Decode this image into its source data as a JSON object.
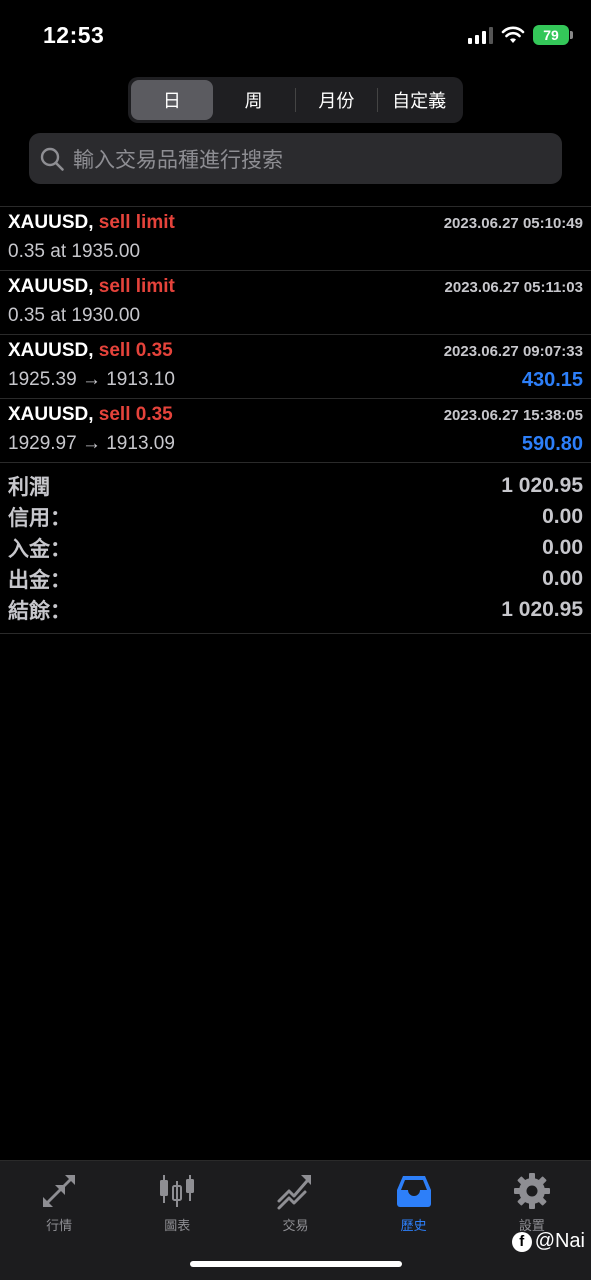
{
  "status_bar": {
    "time": "12:53",
    "battery": "79"
  },
  "segments": [
    {
      "label": "日",
      "active": true
    },
    {
      "label": "周",
      "active": false
    },
    {
      "label": "月份",
      "active": false
    },
    {
      "label": "自定義",
      "active": false
    }
  ],
  "search": {
    "placeholder": "輸入交易品種進行搜索"
  },
  "trades": [
    {
      "symbol": "XAUUSD,",
      "side": "sell limit",
      "time": "2023.06.27 05:10:49",
      "detail": "0.35 at 1935.00",
      "profit": ""
    },
    {
      "symbol": "XAUUSD,",
      "side": "sell limit",
      "time": "2023.06.27 05:11:03",
      "detail": "0.35 at 1930.00",
      "profit": ""
    },
    {
      "symbol": "XAUUSD,",
      "side": "sell 0.35",
      "time": "2023.06.27 09:07:33",
      "detail": "1925.39 → 1913.10",
      "profit": "430.15"
    },
    {
      "symbol": "XAUUSD,",
      "side": "sell 0.35",
      "time": "2023.06.27 15:38:05",
      "detail": "1929.97 → 1913.09",
      "profit": "590.80"
    }
  ],
  "summary": [
    {
      "label": "利潤",
      "value": "1 020.95"
    },
    {
      "label": "信用：",
      "value": "0.00"
    },
    {
      "label": "入金：",
      "value": "0.00"
    },
    {
      "label": "出金：",
      "value": "0.00"
    },
    {
      "label": "結餘：",
      "value": "1 020.95"
    }
  ],
  "tabs": [
    {
      "label": "行情",
      "icon": "quotes-arrows-icon",
      "active": false
    },
    {
      "label": "圖表",
      "icon": "candlestick-chart-icon",
      "active": false
    },
    {
      "label": "交易",
      "icon": "trade-trend-icon",
      "active": false
    },
    {
      "label": "歷史",
      "icon": "inbox-tray-icon",
      "active": true
    },
    {
      "label": "設置",
      "icon": "gear-icon",
      "active": false
    }
  ],
  "watermark": "@Nai",
  "colors": {
    "sell": "#e5433b",
    "profit": "#2d7ff9",
    "active_tab": "#2d7ff9",
    "battery": "#34c759"
  }
}
